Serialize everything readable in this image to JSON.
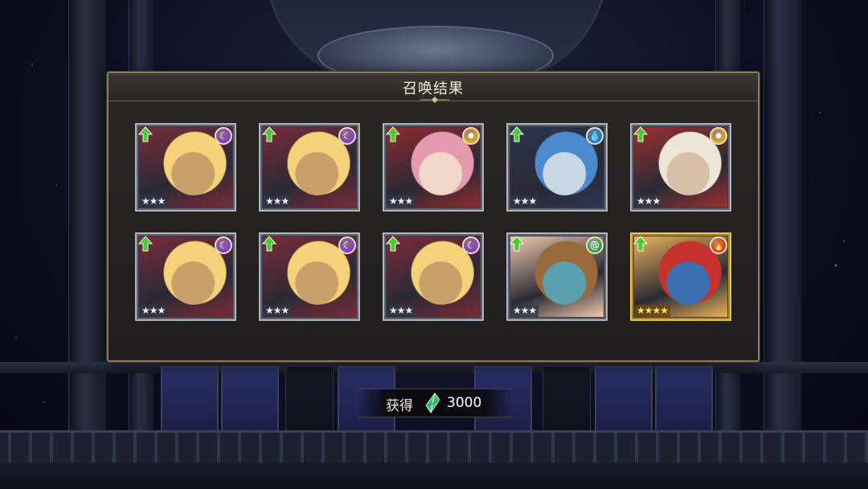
{
  "dialog": {
    "title": "召唤结果"
  },
  "cards": [
    {
      "element": "dark",
      "element_icon": "moon-icon",
      "element_color": "#8b3fc4",
      "rarity_stars": 3,
      "upgrade": true,
      "frame": "silver",
      "art_palette": [
        "#f3d27a",
        "#7b2b3a",
        "#caa06a"
      ]
    },
    {
      "element": "dark",
      "element_icon": "moon-icon",
      "element_color": "#8b3fc4",
      "rarity_stars": 3,
      "upgrade": true,
      "frame": "silver",
      "art_palette": [
        "#f3d27a",
        "#7b2b3a",
        "#caa06a"
      ]
    },
    {
      "element": "light",
      "element_icon": "sun-icon",
      "element_color": "#d8a42a",
      "rarity_stars": 3,
      "upgrade": true,
      "frame": "silver",
      "art_palette": [
        "#e59ab0",
        "#8e2b2e",
        "#f1d7c8"
      ]
    },
    {
      "element": "water",
      "element_icon": "water-drop-icon",
      "element_color": "#2b73c8",
      "rarity_stars": 3,
      "upgrade": true,
      "frame": "silver",
      "art_palette": [
        "#4c8ad0",
        "#2b3552",
        "#c9d6e6"
      ]
    },
    {
      "element": "light",
      "element_icon": "sun-icon",
      "element_color": "#d8a42a",
      "rarity_stars": 3,
      "upgrade": true,
      "frame": "silver",
      "art_palette": [
        "#efe6da",
        "#9a3030",
        "#d9c0a8"
      ]
    },
    {
      "element": "dark",
      "element_icon": "moon-icon",
      "element_color": "#8b3fc4",
      "rarity_stars": 3,
      "upgrade": true,
      "frame": "silver",
      "art_palette": [
        "#f3d27a",
        "#7b2b3a",
        "#caa06a"
      ]
    },
    {
      "element": "dark",
      "element_icon": "moon-icon",
      "element_color": "#8b3fc4",
      "rarity_stars": 3,
      "upgrade": true,
      "frame": "silver",
      "art_palette": [
        "#f3d27a",
        "#7b2b3a",
        "#caa06a"
      ]
    },
    {
      "element": "dark",
      "element_icon": "moon-icon",
      "element_color": "#8b3fc4",
      "rarity_stars": 3,
      "upgrade": true,
      "frame": "silver",
      "art_palette": [
        "#f3d27a",
        "#7b2b3a",
        "#caa06a"
      ]
    },
    {
      "element": "wind",
      "element_icon": "wind-swirl-icon",
      "element_color": "#2e9f4a",
      "rarity_stars": 3,
      "upgrade": true,
      "frame": "silver",
      "art_palette": [
        "#9a6a3c",
        "#f0c9b0",
        "#5aa0b0"
      ]
    },
    {
      "element": "fire",
      "element_icon": "flame-icon",
      "element_color": "#d23a2a",
      "rarity_stars": 4,
      "upgrade": true,
      "frame": "gold",
      "art_palette": [
        "#c8322e",
        "#e9b35a",
        "#3a6fb0"
      ]
    }
  ],
  "reward": {
    "label": "获得",
    "currency_icon": "green-crystal-icon",
    "currency_color": "#4fd48a",
    "amount": "3000"
  },
  "star_glyph": "★"
}
